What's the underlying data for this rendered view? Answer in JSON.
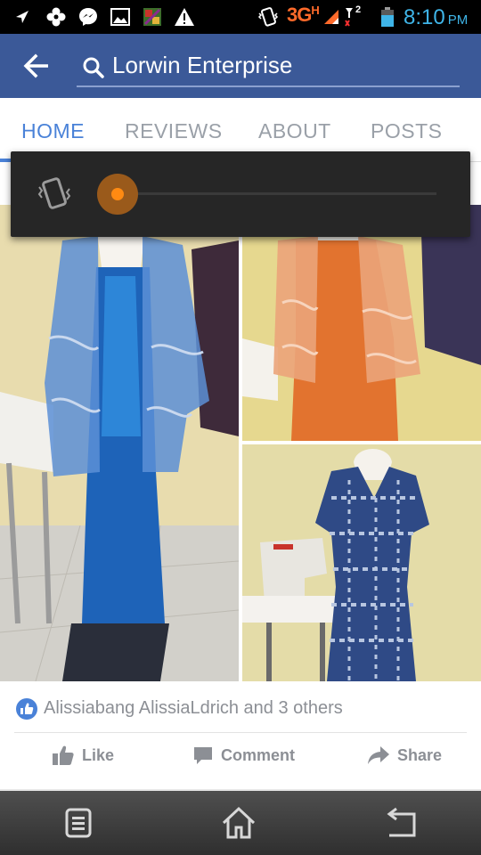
{
  "status_bar": {
    "network": "3G",
    "network_sub": "H",
    "sim_badge": "2",
    "time": "8:10",
    "ampm": "PM",
    "icons": [
      "location-off-icon",
      "flower-icon",
      "messenger-icon",
      "gallery-icon",
      "app-icon",
      "warning-icon",
      "vibrate-icon",
      "signal-icon",
      "signal-2-icon",
      "battery-icon"
    ]
  },
  "app_bar": {
    "search_value": "Lorwin Enterprise"
  },
  "tabs": [
    {
      "label": "HOME",
      "active": true
    },
    {
      "label": "REVIEWS",
      "active": false
    },
    {
      "label": "ABOUT",
      "active": false
    },
    {
      "label": "POSTS",
      "active": false
    }
  ],
  "volume_overlay": {
    "mode_icon": "vibrate-icon",
    "level": 0
  },
  "post": {
    "likes_text": "Alissiabang AlissiaLdrich and 3 others",
    "actions": {
      "like": "Like",
      "comment": "Comment",
      "share": "Share"
    }
  },
  "colors": {
    "facebook_blue": "#3b5998",
    "tab_active": "#4a82d8",
    "volume_thumb": "#ff8a12",
    "network_orange": "#ff6a2a",
    "clock_blue": "#3fb5e8"
  },
  "nav_bar": {
    "icons": [
      "menu-icon",
      "home-icon",
      "back-icon"
    ]
  }
}
